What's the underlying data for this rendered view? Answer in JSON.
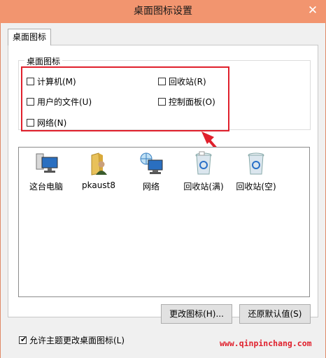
{
  "window": {
    "title": "桌面图标设置",
    "close_glyph": "✕"
  },
  "tab": {
    "label": "桌面图标"
  },
  "group": {
    "label": "桌面图标",
    "checkboxes": [
      {
        "label": "计算机(M)",
        "checked": false
      },
      {
        "label": "回收站(R)",
        "checked": false
      },
      {
        "label": "用户的文件(U)",
        "checked": false
      },
      {
        "label": "控制面板(O)",
        "checked": false
      },
      {
        "label": "网络(N)",
        "checked": false
      }
    ]
  },
  "icons": [
    {
      "label": "这台电脑",
      "icon": "computer-icon"
    },
    {
      "label": "pkaust8",
      "icon": "user-folder-icon"
    },
    {
      "label": "网络",
      "icon": "network-icon"
    },
    {
      "label": "回收站(满)",
      "icon": "recycle-bin-full-icon"
    },
    {
      "label": "回收站(空)",
      "icon": "recycle-bin-empty-icon"
    }
  ],
  "buttons": {
    "change_icon": "更改图标(H)...",
    "restore_default": "还原默认值(S)"
  },
  "theme_checkbox": {
    "label": "允许主题更改桌面图标(L)",
    "checked": true
  },
  "watermark": "www.qinpinchang.com",
  "colors": {
    "titlebar": "#f2956f",
    "highlight": "#e0202c"
  }
}
